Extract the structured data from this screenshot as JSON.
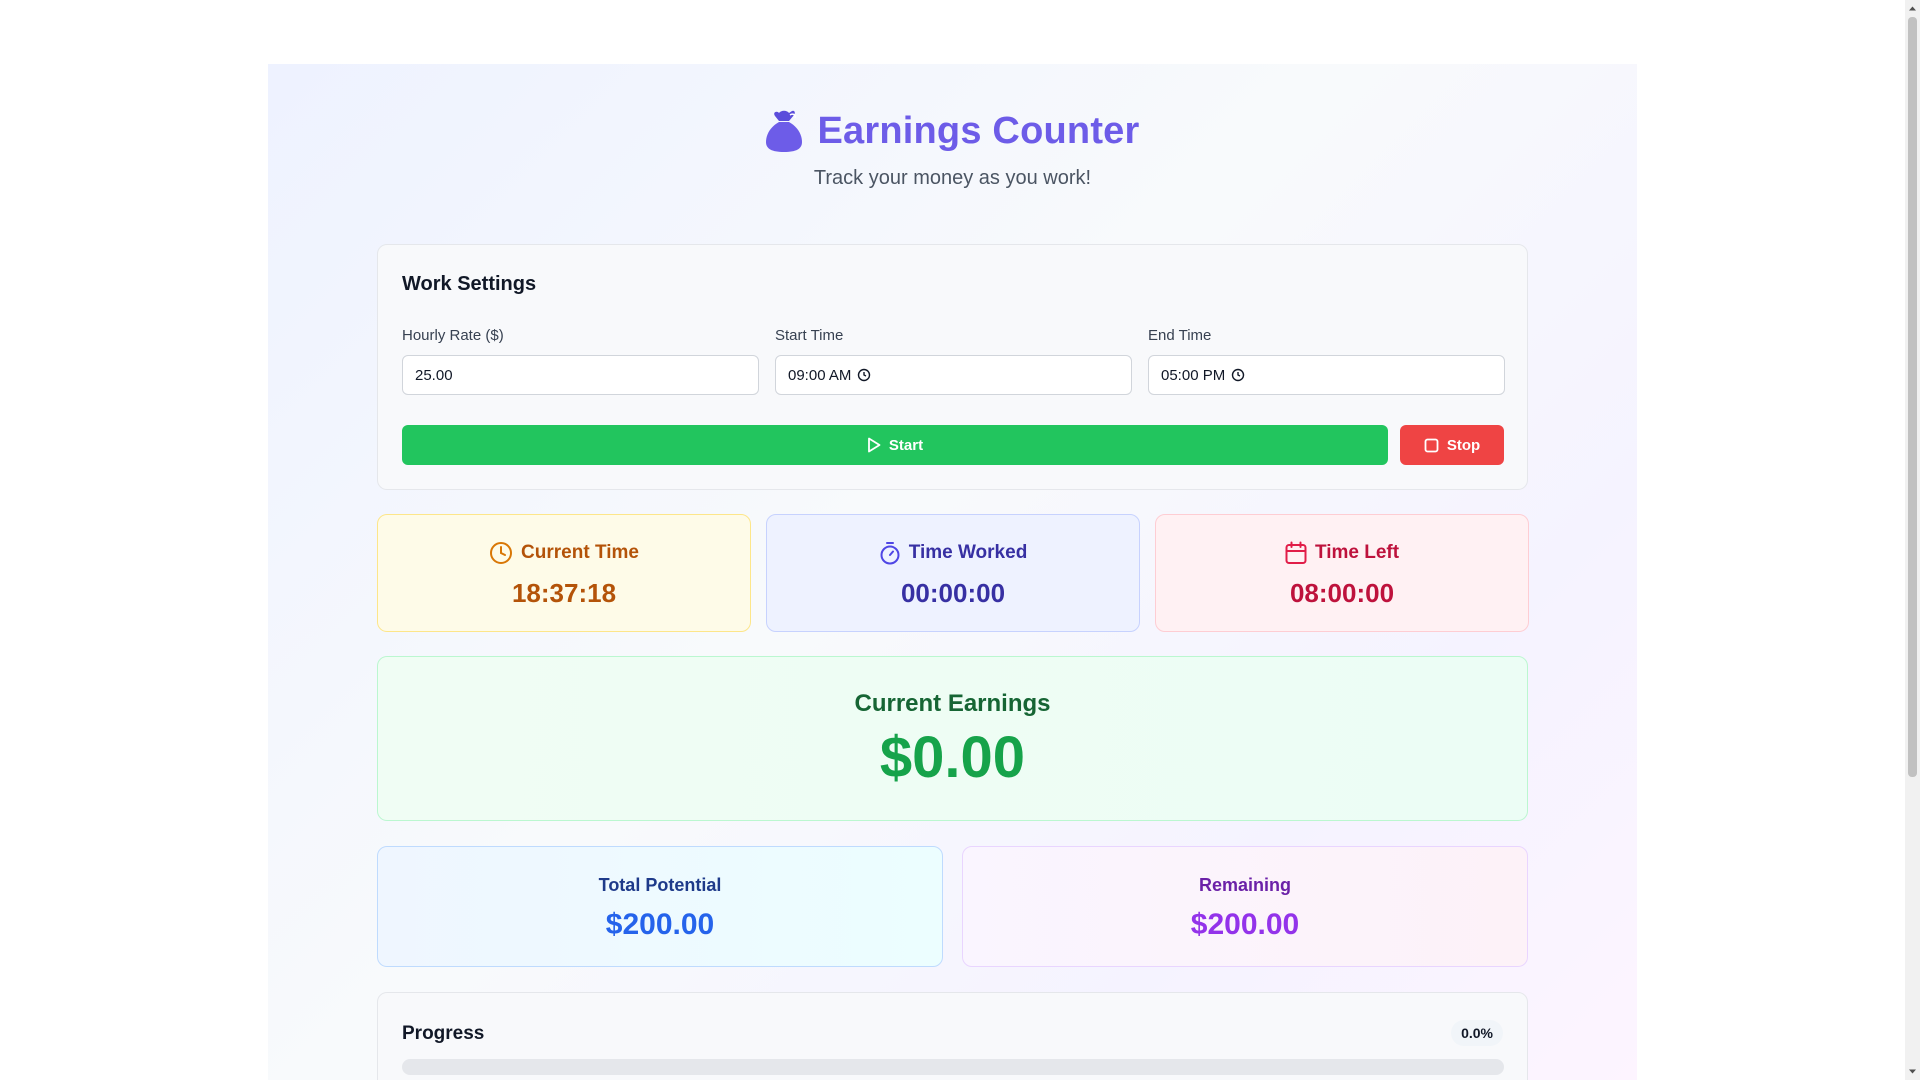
{
  "header": {
    "title": "Earnings Counter",
    "subtitle": "Track your money as you work!",
    "icon": "money-bag-icon",
    "accent_color": "#6d5ce8"
  },
  "settings": {
    "heading": "Work Settings",
    "hourly_rate_label": "Hourly Rate ($)",
    "hourly_rate_value": "25.00",
    "start_time_label": "Start Time",
    "start_time_value": "09:00 AM",
    "end_time_label": "End Time",
    "end_time_value": "05:00 PM",
    "start_button": "Start",
    "stop_button": "Stop",
    "start_color": "#22c55e",
    "stop_color": "#ef4444"
  },
  "stats": {
    "current_time_label": "Current Time",
    "current_time_value": "18:37:18",
    "time_worked_label": "Time Worked",
    "time_worked_value": "00:00:00",
    "time_left_label": "Time Left",
    "time_left_value": "08:00:00"
  },
  "earnings": {
    "label": "Current Earnings",
    "value": "$0.00"
  },
  "potential": {
    "total_label": "Total Potential",
    "total_value": "$200.00",
    "remaining_label": "Remaining",
    "remaining_value": "$200.00"
  },
  "progress": {
    "label": "Progress",
    "percent_text": "0.0%",
    "fraction": 0.0
  }
}
